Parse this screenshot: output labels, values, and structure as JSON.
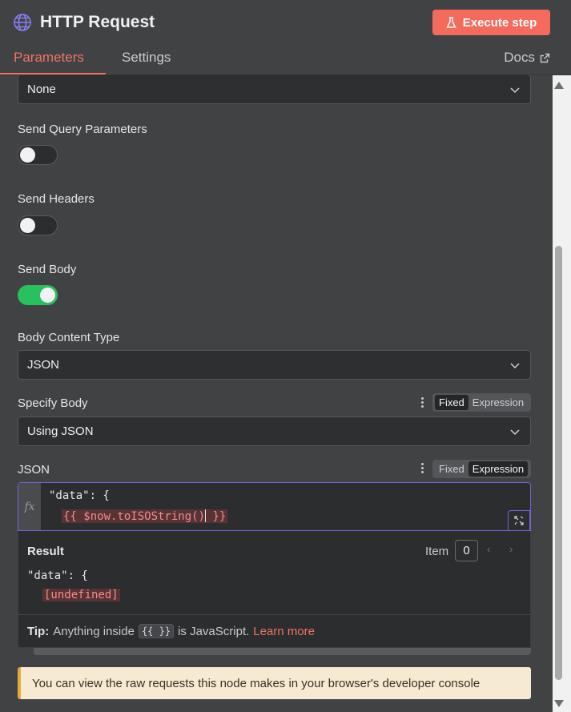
{
  "header": {
    "title": "HTTP Request",
    "execute_label": "Execute step",
    "tabs": [
      {
        "label": "Parameters",
        "active": true
      },
      {
        "label": "Settings",
        "active": false
      }
    ],
    "docs_label": "Docs",
    "accent_color": "#f46a5d"
  },
  "params": {
    "top_select_value": "None",
    "send_query": {
      "label": "Send Query Parameters",
      "enabled": false
    },
    "send_headers": {
      "label": "Send Headers",
      "enabled": false
    },
    "send_body": {
      "label": "Send Body",
      "enabled": true
    },
    "body_content_type": {
      "label": "Body Content Type",
      "value": "JSON"
    },
    "specify_body": {
      "label": "Specify Body",
      "mode_fixed": "Fixed",
      "mode_expression": "Expression",
      "active_mode": "Fixed",
      "value": "Using JSON"
    },
    "json": {
      "label": "JSON",
      "mode_fixed": "Fixed",
      "mode_expression": "Expression",
      "active_mode": "Expression",
      "fx_label": "fx",
      "code_line1": "\"data\": {",
      "code_line2_a": "{{ $now.toISOString()",
      "code_line2_b": " }}"
    }
  },
  "result": {
    "title": "Result",
    "item_label": "Item",
    "item_value": "0",
    "line1": "\"data\": {",
    "line2": "[undefined]",
    "tip_bold": "Tip:",
    "tip_text": "Anything inside",
    "tip_code": "{{ }}",
    "tip_text2": "is JavaScript.",
    "learn_more": "Learn more"
  },
  "notice": {
    "text": "You can view the raw requests this node makes in your browser's developer console"
  },
  "icons": {
    "title_icon": "globe-icon",
    "execute_icon": "flask-icon",
    "docs_icon": "external-link-icon",
    "select_icon": "chevron-down-icon",
    "menu_icon": "kebab-menu-icon",
    "expand_icon": "expand-icon"
  }
}
